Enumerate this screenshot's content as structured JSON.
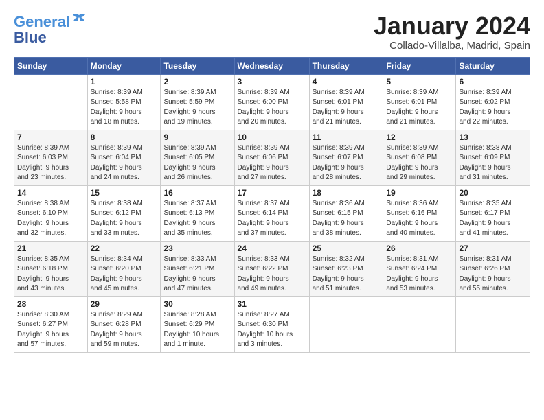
{
  "logo": {
    "line1": "General",
    "line2": "Blue"
  },
  "title": "January 2024",
  "subtitle": "Collado-Villalba, Madrid, Spain",
  "weekdays": [
    "Sunday",
    "Monday",
    "Tuesday",
    "Wednesday",
    "Thursday",
    "Friday",
    "Saturday"
  ],
  "weeks": [
    [
      {
        "day": "",
        "info": ""
      },
      {
        "day": "1",
        "info": "Sunrise: 8:39 AM\nSunset: 5:58 PM\nDaylight: 9 hours\nand 18 minutes."
      },
      {
        "day": "2",
        "info": "Sunrise: 8:39 AM\nSunset: 5:59 PM\nDaylight: 9 hours\nand 19 minutes."
      },
      {
        "day": "3",
        "info": "Sunrise: 8:39 AM\nSunset: 6:00 PM\nDaylight: 9 hours\nand 20 minutes."
      },
      {
        "day": "4",
        "info": "Sunrise: 8:39 AM\nSunset: 6:01 PM\nDaylight: 9 hours\nand 21 minutes."
      },
      {
        "day": "5",
        "info": "Sunrise: 8:39 AM\nSunset: 6:01 PM\nDaylight: 9 hours\nand 21 minutes."
      },
      {
        "day": "6",
        "info": "Sunrise: 8:39 AM\nSunset: 6:02 PM\nDaylight: 9 hours\nand 22 minutes."
      }
    ],
    [
      {
        "day": "7",
        "info": "Sunrise: 8:39 AM\nSunset: 6:03 PM\nDaylight: 9 hours\nand 23 minutes."
      },
      {
        "day": "8",
        "info": "Sunrise: 8:39 AM\nSunset: 6:04 PM\nDaylight: 9 hours\nand 24 minutes."
      },
      {
        "day": "9",
        "info": "Sunrise: 8:39 AM\nSunset: 6:05 PM\nDaylight: 9 hours\nand 26 minutes."
      },
      {
        "day": "10",
        "info": "Sunrise: 8:39 AM\nSunset: 6:06 PM\nDaylight: 9 hours\nand 27 minutes."
      },
      {
        "day": "11",
        "info": "Sunrise: 8:39 AM\nSunset: 6:07 PM\nDaylight: 9 hours\nand 28 minutes."
      },
      {
        "day": "12",
        "info": "Sunrise: 8:39 AM\nSunset: 6:08 PM\nDaylight: 9 hours\nand 29 minutes."
      },
      {
        "day": "13",
        "info": "Sunrise: 8:38 AM\nSunset: 6:09 PM\nDaylight: 9 hours\nand 31 minutes."
      }
    ],
    [
      {
        "day": "14",
        "info": "Sunrise: 8:38 AM\nSunset: 6:10 PM\nDaylight: 9 hours\nand 32 minutes."
      },
      {
        "day": "15",
        "info": "Sunrise: 8:38 AM\nSunset: 6:12 PM\nDaylight: 9 hours\nand 33 minutes."
      },
      {
        "day": "16",
        "info": "Sunrise: 8:37 AM\nSunset: 6:13 PM\nDaylight: 9 hours\nand 35 minutes."
      },
      {
        "day": "17",
        "info": "Sunrise: 8:37 AM\nSunset: 6:14 PM\nDaylight: 9 hours\nand 37 minutes."
      },
      {
        "day": "18",
        "info": "Sunrise: 8:36 AM\nSunset: 6:15 PM\nDaylight: 9 hours\nand 38 minutes."
      },
      {
        "day": "19",
        "info": "Sunrise: 8:36 AM\nSunset: 6:16 PM\nDaylight: 9 hours\nand 40 minutes."
      },
      {
        "day": "20",
        "info": "Sunrise: 8:35 AM\nSunset: 6:17 PM\nDaylight: 9 hours\nand 41 minutes."
      }
    ],
    [
      {
        "day": "21",
        "info": "Sunrise: 8:35 AM\nSunset: 6:18 PM\nDaylight: 9 hours\nand 43 minutes."
      },
      {
        "day": "22",
        "info": "Sunrise: 8:34 AM\nSunset: 6:20 PM\nDaylight: 9 hours\nand 45 minutes."
      },
      {
        "day": "23",
        "info": "Sunrise: 8:33 AM\nSunset: 6:21 PM\nDaylight: 9 hours\nand 47 minutes."
      },
      {
        "day": "24",
        "info": "Sunrise: 8:33 AM\nSunset: 6:22 PM\nDaylight: 9 hours\nand 49 minutes."
      },
      {
        "day": "25",
        "info": "Sunrise: 8:32 AM\nSunset: 6:23 PM\nDaylight: 9 hours\nand 51 minutes."
      },
      {
        "day": "26",
        "info": "Sunrise: 8:31 AM\nSunset: 6:24 PM\nDaylight: 9 hours\nand 53 minutes."
      },
      {
        "day": "27",
        "info": "Sunrise: 8:31 AM\nSunset: 6:26 PM\nDaylight: 9 hours\nand 55 minutes."
      }
    ],
    [
      {
        "day": "28",
        "info": "Sunrise: 8:30 AM\nSunset: 6:27 PM\nDaylight: 9 hours\nand 57 minutes."
      },
      {
        "day": "29",
        "info": "Sunrise: 8:29 AM\nSunset: 6:28 PM\nDaylight: 9 hours\nand 59 minutes."
      },
      {
        "day": "30",
        "info": "Sunrise: 8:28 AM\nSunset: 6:29 PM\nDaylight: 10 hours\nand 1 minute."
      },
      {
        "day": "31",
        "info": "Sunrise: 8:27 AM\nSunset: 6:30 PM\nDaylight: 10 hours\nand 3 minutes."
      },
      {
        "day": "",
        "info": ""
      },
      {
        "day": "",
        "info": ""
      },
      {
        "day": "",
        "info": ""
      }
    ]
  ]
}
